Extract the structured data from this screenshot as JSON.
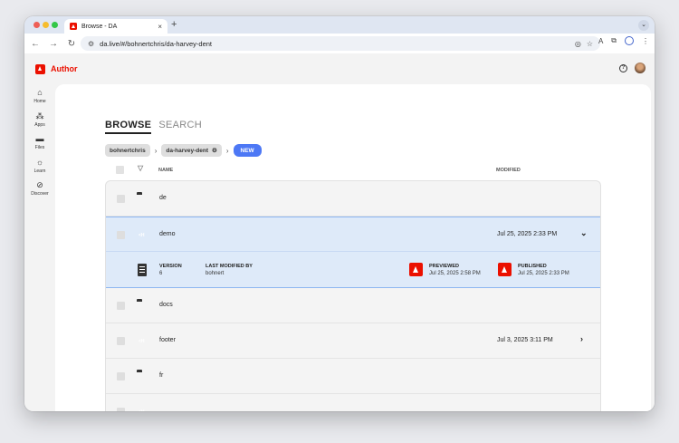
{
  "browser": {
    "tab_title": "Browse - DA",
    "tab_close": "×",
    "new_tab": "+",
    "url": "da.live/#/bohnertchris/da-harvey-dent"
  },
  "app": {
    "brand": "Author",
    "help": "?"
  },
  "sidebar": {
    "items": [
      {
        "label": "Home",
        "icon": "home-icon"
      },
      {
        "label": "Apps",
        "icon": "apps-icon"
      },
      {
        "label": "Files",
        "icon": "folder-icon"
      },
      {
        "label": "Learn",
        "icon": "lightbulb-icon"
      },
      {
        "label": "Discover",
        "icon": "compass-icon"
      }
    ]
  },
  "tabs": {
    "browse": "BROWSE",
    "search": "SEARCH"
  },
  "breadcrumb": {
    "items": [
      "bohnertchris",
      "da-harvey-dent"
    ],
    "new_label": "NEW"
  },
  "list": {
    "header_name": "NAME",
    "header_modified": "MODIFIED",
    "rows": [
      {
        "name": "de",
        "type": "folder",
        "modified": ""
      },
      {
        "name": "demo",
        "type": "doc",
        "modified": "Jul 25, 2025 2:33 PM"
      },
      {
        "name": "docs",
        "type": "folder",
        "modified": ""
      },
      {
        "name": "footer",
        "type": "doc",
        "modified": "Jul 3, 2025 3:11 PM"
      },
      {
        "name": "fr",
        "type": "folder",
        "modified": ""
      }
    ]
  },
  "detail": {
    "version_label": "VERSION",
    "version_value": "6",
    "last_modified_label": "LAST MODIFIED BY",
    "last_modified_value": "bohnert",
    "previewed_label": "PREVIEWED",
    "previewed_value": "Jul 25, 2025 2:58 PM",
    "published_label": "PUBLISHED",
    "published_value": "Jul 25, 2025 2:33 PM"
  },
  "colors": {
    "brand": "#eb1000",
    "accent": "#4d78f5",
    "selected_row": "#deeaf9"
  }
}
